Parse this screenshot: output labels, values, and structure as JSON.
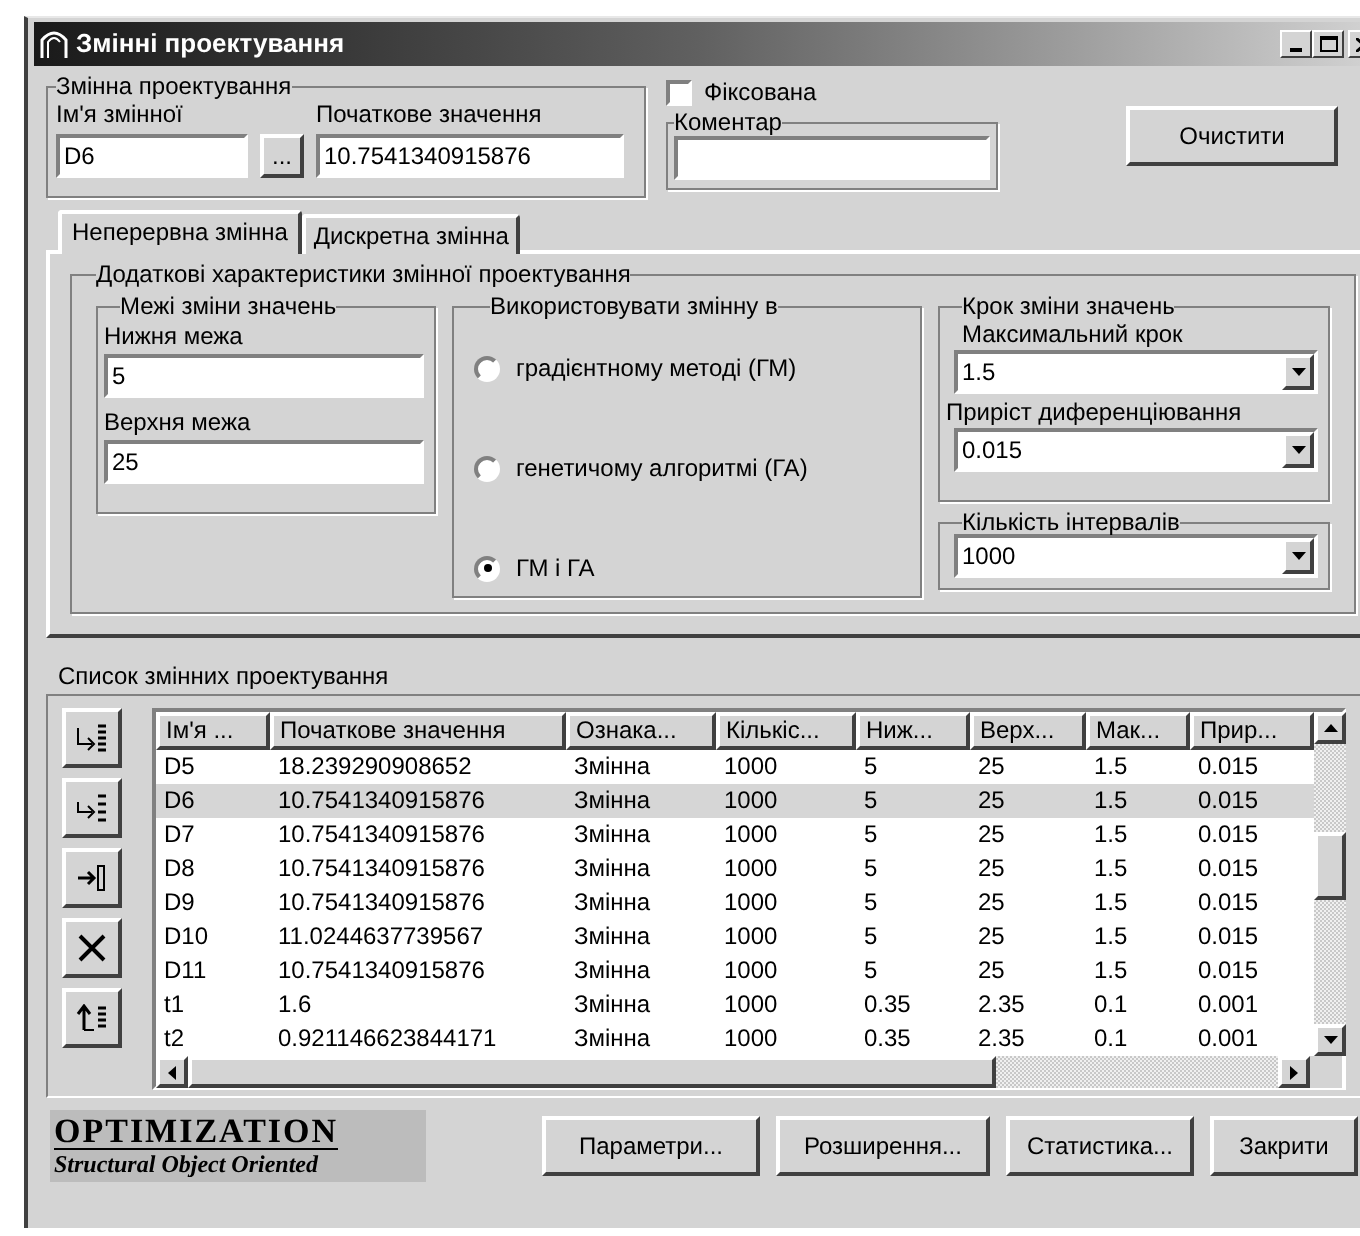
{
  "window": {
    "title": "Змінні проектування"
  },
  "design_variable": {
    "group_title": "Змінна проектування",
    "name_label": "Ім'я змінної",
    "name_value": "D6",
    "browse_button": "...",
    "initial_label": "Початкове значення",
    "initial_value": "10.7541340915876"
  },
  "fixed": {
    "label": "Фіксована",
    "checked": false
  },
  "comment": {
    "group_title": "Коментар"
  },
  "clear_button": "Очистити",
  "tabs": [
    {
      "label": "Неперервна змінна",
      "selected": true
    },
    {
      "label": "Дискретна змінна",
      "selected": false
    }
  ],
  "extra": {
    "title": "Додаткові характеристики змінної проектування",
    "bounds": {
      "title": "Межі зміни значень",
      "lower_label": "Нижня межа",
      "lower_value": "5",
      "upper_label": "Верхня межа",
      "upper_value": "25"
    },
    "use_in": {
      "title": "Використовувати змінну в",
      "options": [
        {
          "label": "градієнтному методі (ГМ)",
          "selected": false
        },
        {
          "label": "генетичому алгоритмі (ГА)",
          "selected": false
        },
        {
          "label": "ГМ і ГА",
          "selected": true
        }
      ]
    },
    "step": {
      "title": "Крок зміни значень",
      "max_label": "Максимальний крок",
      "max_value": "1.5",
      "diff_label": "Приріст диференціювання",
      "diff_value": "0.015"
    },
    "intervals": {
      "title": "Кількість інтервалів",
      "value": "1000"
    }
  },
  "list": {
    "title": "Список змінних проектування",
    "columns": [
      "Ім'я ...",
      "Початкове значення",
      "Ознака...",
      "Кількіс...",
      "Ниж...",
      "Верх...",
      "Мак...",
      "Прир..."
    ],
    "rows": [
      {
        "cells": [
          "D5",
          "18.239290908652",
          "Змінна",
          "1000",
          "5",
          "25",
          "1.5",
          "0.015"
        ],
        "selected": false
      },
      {
        "cells": [
          "D6",
          "10.7541340915876",
          "Змінна",
          "1000",
          "5",
          "25",
          "1.5",
          "0.015"
        ],
        "selected": true
      },
      {
        "cells": [
          "D7",
          "10.7541340915876",
          "Змінна",
          "1000",
          "5",
          "25",
          "1.5",
          "0.015"
        ],
        "selected": false
      },
      {
        "cells": [
          "D8",
          "10.7541340915876",
          "Змінна",
          "1000",
          "5",
          "25",
          "1.5",
          "0.015"
        ],
        "selected": false
      },
      {
        "cells": [
          "D9",
          "10.7541340915876",
          "Змінна",
          "1000",
          "5",
          "25",
          "1.5",
          "0.015"
        ],
        "selected": false
      },
      {
        "cells": [
          "D10",
          "11.0244637739567",
          "Змінна",
          "1000",
          "5",
          "25",
          "1.5",
          "0.015"
        ],
        "selected": false
      },
      {
        "cells": [
          "D11",
          "10.7541340915876",
          "Змінна",
          "1000",
          "5",
          "25",
          "1.5",
          "0.015"
        ],
        "selected": false
      },
      {
        "cells": [
          "t1",
          "1.6",
          "Змінна",
          "1000",
          "0.35",
          "2.35",
          "0.1",
          "0.001"
        ],
        "selected": false
      },
      {
        "cells": [
          "t2",
          "0.921146623844171",
          "Змінна",
          "1000",
          "0.35",
          "2.35",
          "0.1",
          "0.001"
        ],
        "selected": false
      }
    ]
  },
  "logo": {
    "title": "OPTIMIZATION",
    "subtitle": "Structural Object Oriented"
  },
  "buttons": [
    "Параметри...",
    "Розширення...",
    "Статистика...",
    "Закрити"
  ]
}
